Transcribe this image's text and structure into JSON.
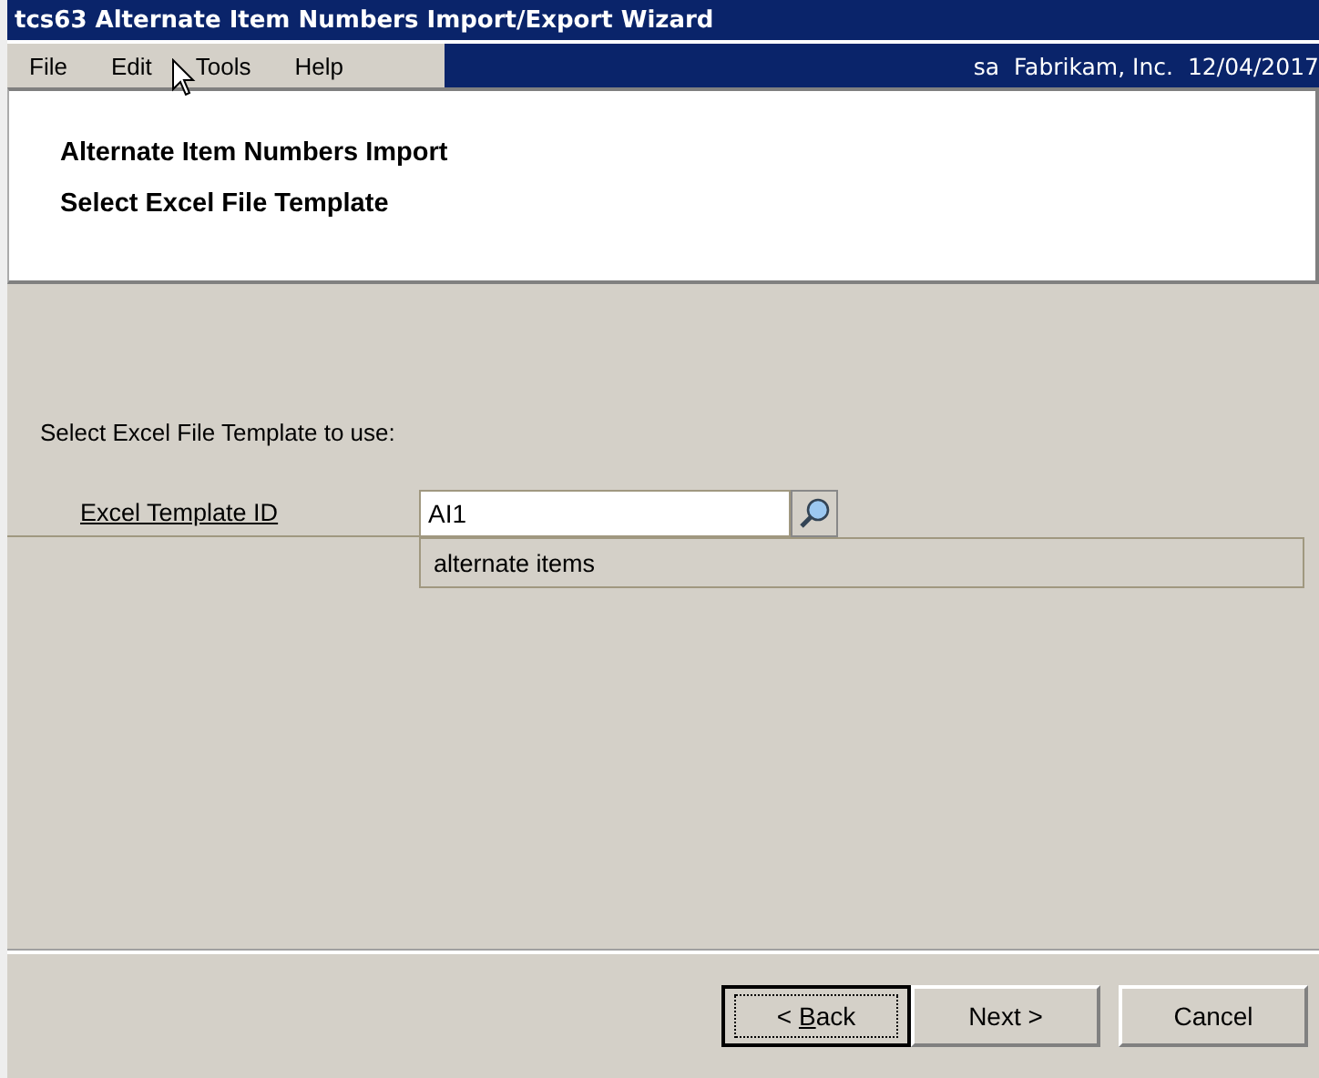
{
  "window": {
    "title": "tcs63 Alternate Item Numbers Import/Export Wizard"
  },
  "menu": [
    "File",
    "Edit",
    "Tools",
    "Help"
  ],
  "user_info": "sa  Fabrikam, Inc.  12/04/2017",
  "header": {
    "title": "Alternate Item Numbers Import",
    "subtitle": "Select Excel File Template"
  },
  "prompt": "Select Excel File Template to use:",
  "template_field": {
    "label": "Excel Template ID",
    "value": "AI1",
    "description": "alternate items"
  },
  "buttons": [
    {
      "before": "< ",
      "accelerator": "B",
      "after": "ack",
      "focused": true
    },
    {
      "before": "Next >",
      "focused": false
    },
    {
      "before": "Cancel",
      "focused": false
    }
  ]
}
